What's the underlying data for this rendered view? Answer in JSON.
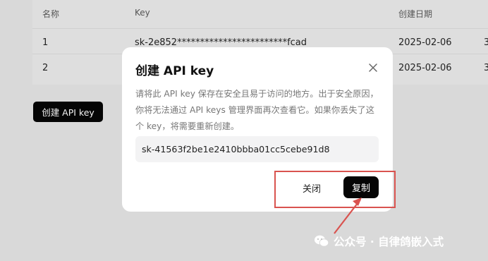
{
  "table": {
    "headers": {
      "name": "名称",
      "key": "Key",
      "date": "创建日期"
    },
    "rows": [
      {
        "name": "1",
        "key": "sk-2e852************************fcad",
        "date": "2025-02-06",
        "more": "3"
      },
      {
        "name": "2",
        "key": "",
        "date": "2025-02-06",
        "more": "3"
      }
    ]
  },
  "page": {
    "create_button": "创建 API key"
  },
  "modal": {
    "title": "创建 API key",
    "description": "请将此 API key 保存在安全且易于访问的地方。出于安全原因，你将无法通过 API keys 管理界面再次查看它。如果你丢失了这个 key，将需要重新创建。",
    "key_value": "sk-41563f2be1e2410bbba01cc5cebe91d8",
    "close_label": "关闭",
    "copy_label": "复制"
  },
  "watermark": {
    "text": "公众号 · 自律鸽嵌入式",
    "icon": "wechat-icon"
  },
  "colors": {
    "annotation": "#d9534f",
    "button_dark": "#050505",
    "overlay": "#d9d9d9"
  }
}
